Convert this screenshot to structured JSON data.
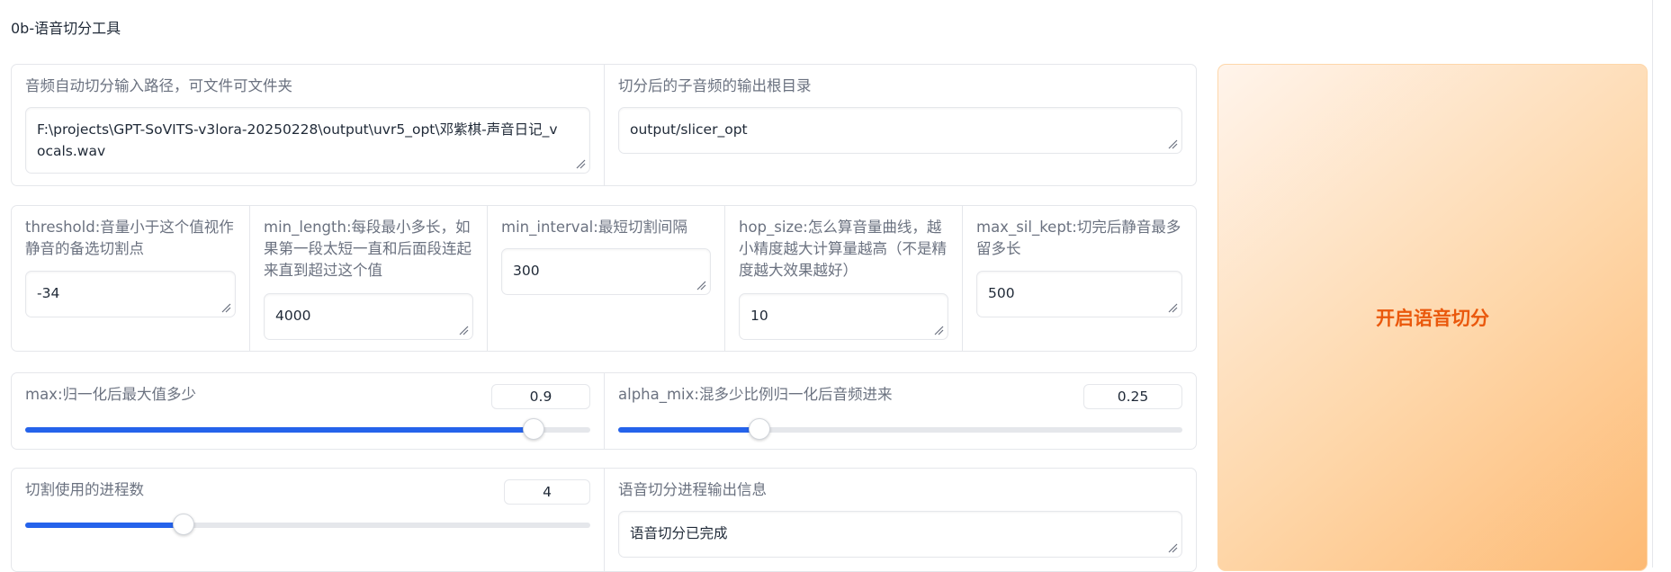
{
  "page": {
    "title": "0b-语音切分工具"
  },
  "paths": {
    "input_label": "音频自动切分输入路径，可文件可文件夹",
    "input_value": "F:\\projects\\GPT-SoVITS-v3lora-20250228\\output\\uvr5_opt\\邓紫棋-声音日记_vocals.wav",
    "output_label": "切分后的子音频的输出根目录",
    "output_value": "output/slicer_opt"
  },
  "params": [
    {
      "label": "threshold:音量小于这个值视作静音的备选切割点",
      "value": "-34"
    },
    {
      "label": "min_length:每段最小多长，如果第一段太短一直和后面段连起来直到超过这个值",
      "value": "4000"
    },
    {
      "label": "min_interval:最短切割间隔",
      "value": "300"
    },
    {
      "label": "hop_size:怎么算音量曲线，越小精度越大计算量越高（不是精度越大效果越好）",
      "value": "10"
    },
    {
      "label": "max_sil_kept:切完后静音最多留多长",
      "value": "500"
    }
  ],
  "sliders": {
    "max": {
      "label": "max:归一化后最大值多少",
      "value": "0.9",
      "fraction": 0.9
    },
    "alpha": {
      "label": "alpha_mix:混多少比例归一化后音频进来",
      "value": "0.25",
      "fraction": 0.25
    },
    "procs": {
      "label": "切割使用的进程数",
      "value": "4",
      "fraction": 0.28
    }
  },
  "log": {
    "label": "语音切分进程输出信息",
    "value": "语音切分已完成"
  },
  "start_button": {
    "label": "开启语音切分"
  },
  "colors": {
    "accent": "#2563eb",
    "button_text": "#ea580c",
    "button_bg": "#fdba74"
  }
}
